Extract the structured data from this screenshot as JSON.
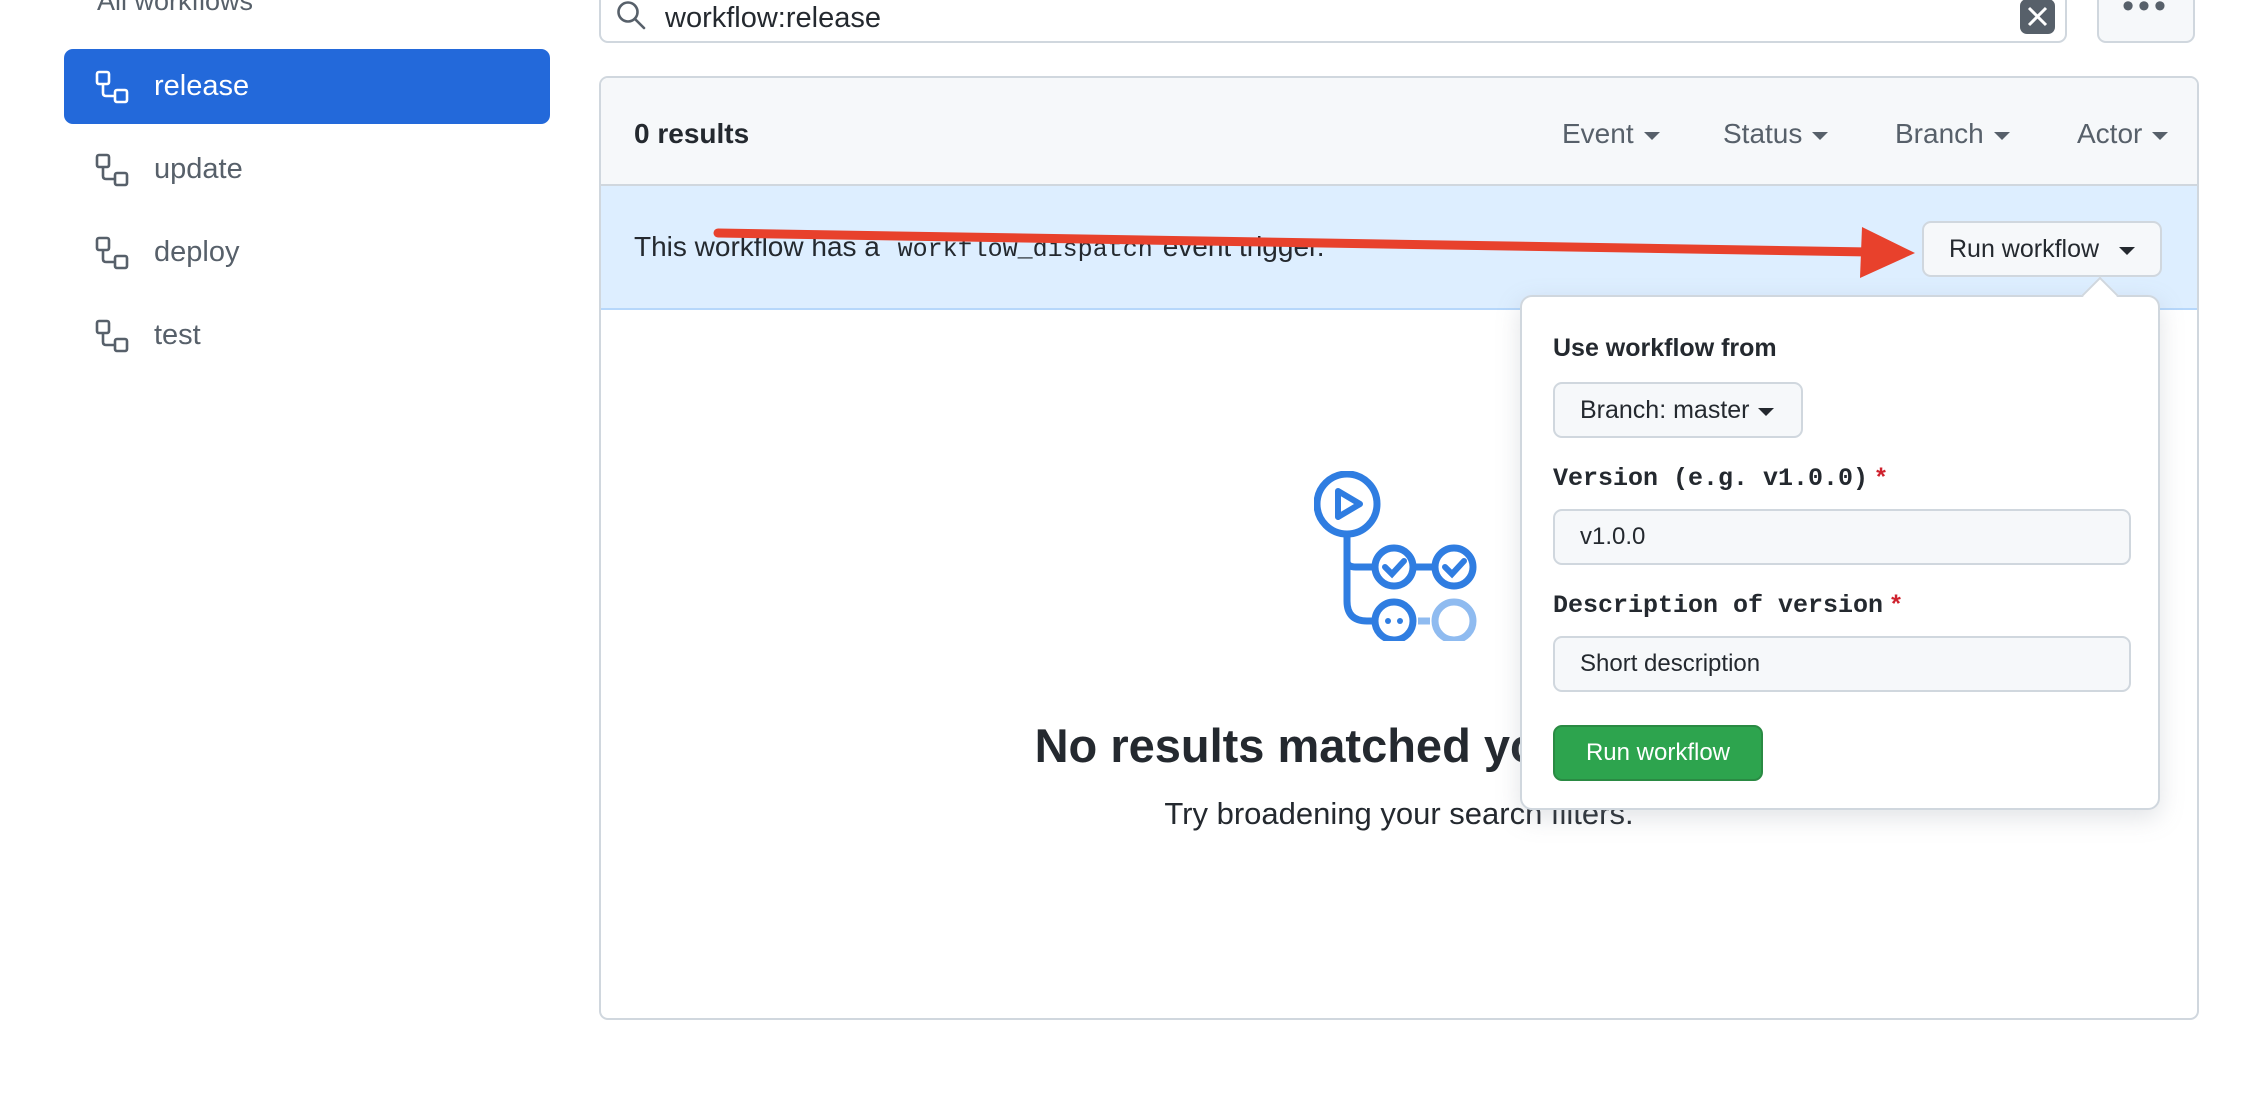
{
  "sidebar": {
    "all_workflows": "All workflows",
    "items": [
      {
        "label": "release",
        "active": true
      },
      {
        "label": "update",
        "active": false
      },
      {
        "label": "deploy",
        "active": false
      },
      {
        "label": "test",
        "active": false
      }
    ]
  },
  "search": {
    "query": "workflow:release",
    "icon": "search-icon"
  },
  "header": {
    "results": "0 results",
    "filters": [
      "Event",
      "Status",
      "Branch",
      "Actor"
    ]
  },
  "dispatch": {
    "text_before": "This workflow has a",
    "code": "workflow_dispatch",
    "text_after": "event trigger.",
    "run_button": "Run workflow"
  },
  "blank_slate": {
    "title": "No results matched your search.",
    "subtitle": "Try broadening your search filters."
  },
  "dropdown": {
    "heading": "Use workflow from",
    "branch_button": "Branch: master",
    "fields": [
      {
        "label": "Version (e.g. v1.0.0)",
        "value": "v1.0.0",
        "required": true
      },
      {
        "label": "Description of version",
        "value": "Short description",
        "required": true
      }
    ],
    "submit": "Run workflow"
  },
  "colors": {
    "active_nav": "#2369da",
    "dispatch_bg": "#ddeeff",
    "run_green": "#2da44e",
    "annotation_arrow": "#e8412c",
    "required_star": "#cf222e"
  }
}
